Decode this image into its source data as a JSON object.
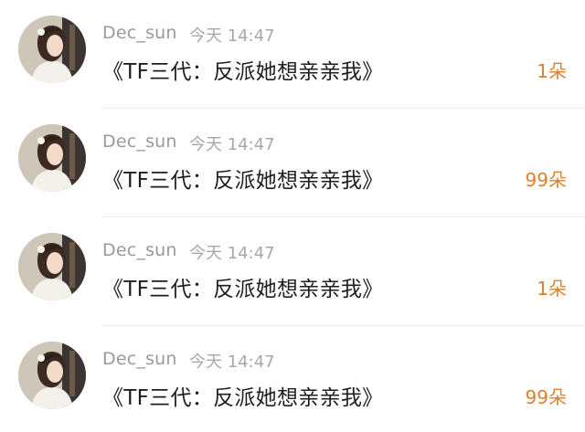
{
  "messages": [
    {
      "username": "Dec_sun",
      "time": "今天 14:47",
      "title": "《TF三代：反派她想亲亲我》",
      "count": "1朵"
    },
    {
      "username": "Dec_sun",
      "time": "今天 14:47",
      "title": "《TF三代：反派她想亲亲我》",
      "count": "99朵"
    },
    {
      "username": "Dec_sun",
      "time": "今天 14:47",
      "title": "《TF三代：反派她想亲亲我》",
      "count": "1朵"
    },
    {
      "username": "Dec_sun",
      "time": "今天 14:47",
      "title": "《TF三代：反派她想亲亲我》",
      "count": "99朵"
    }
  ],
  "colors": {
    "count": "#e07f2e",
    "username": "#9a9a9a",
    "title": "#1e1e1e"
  }
}
